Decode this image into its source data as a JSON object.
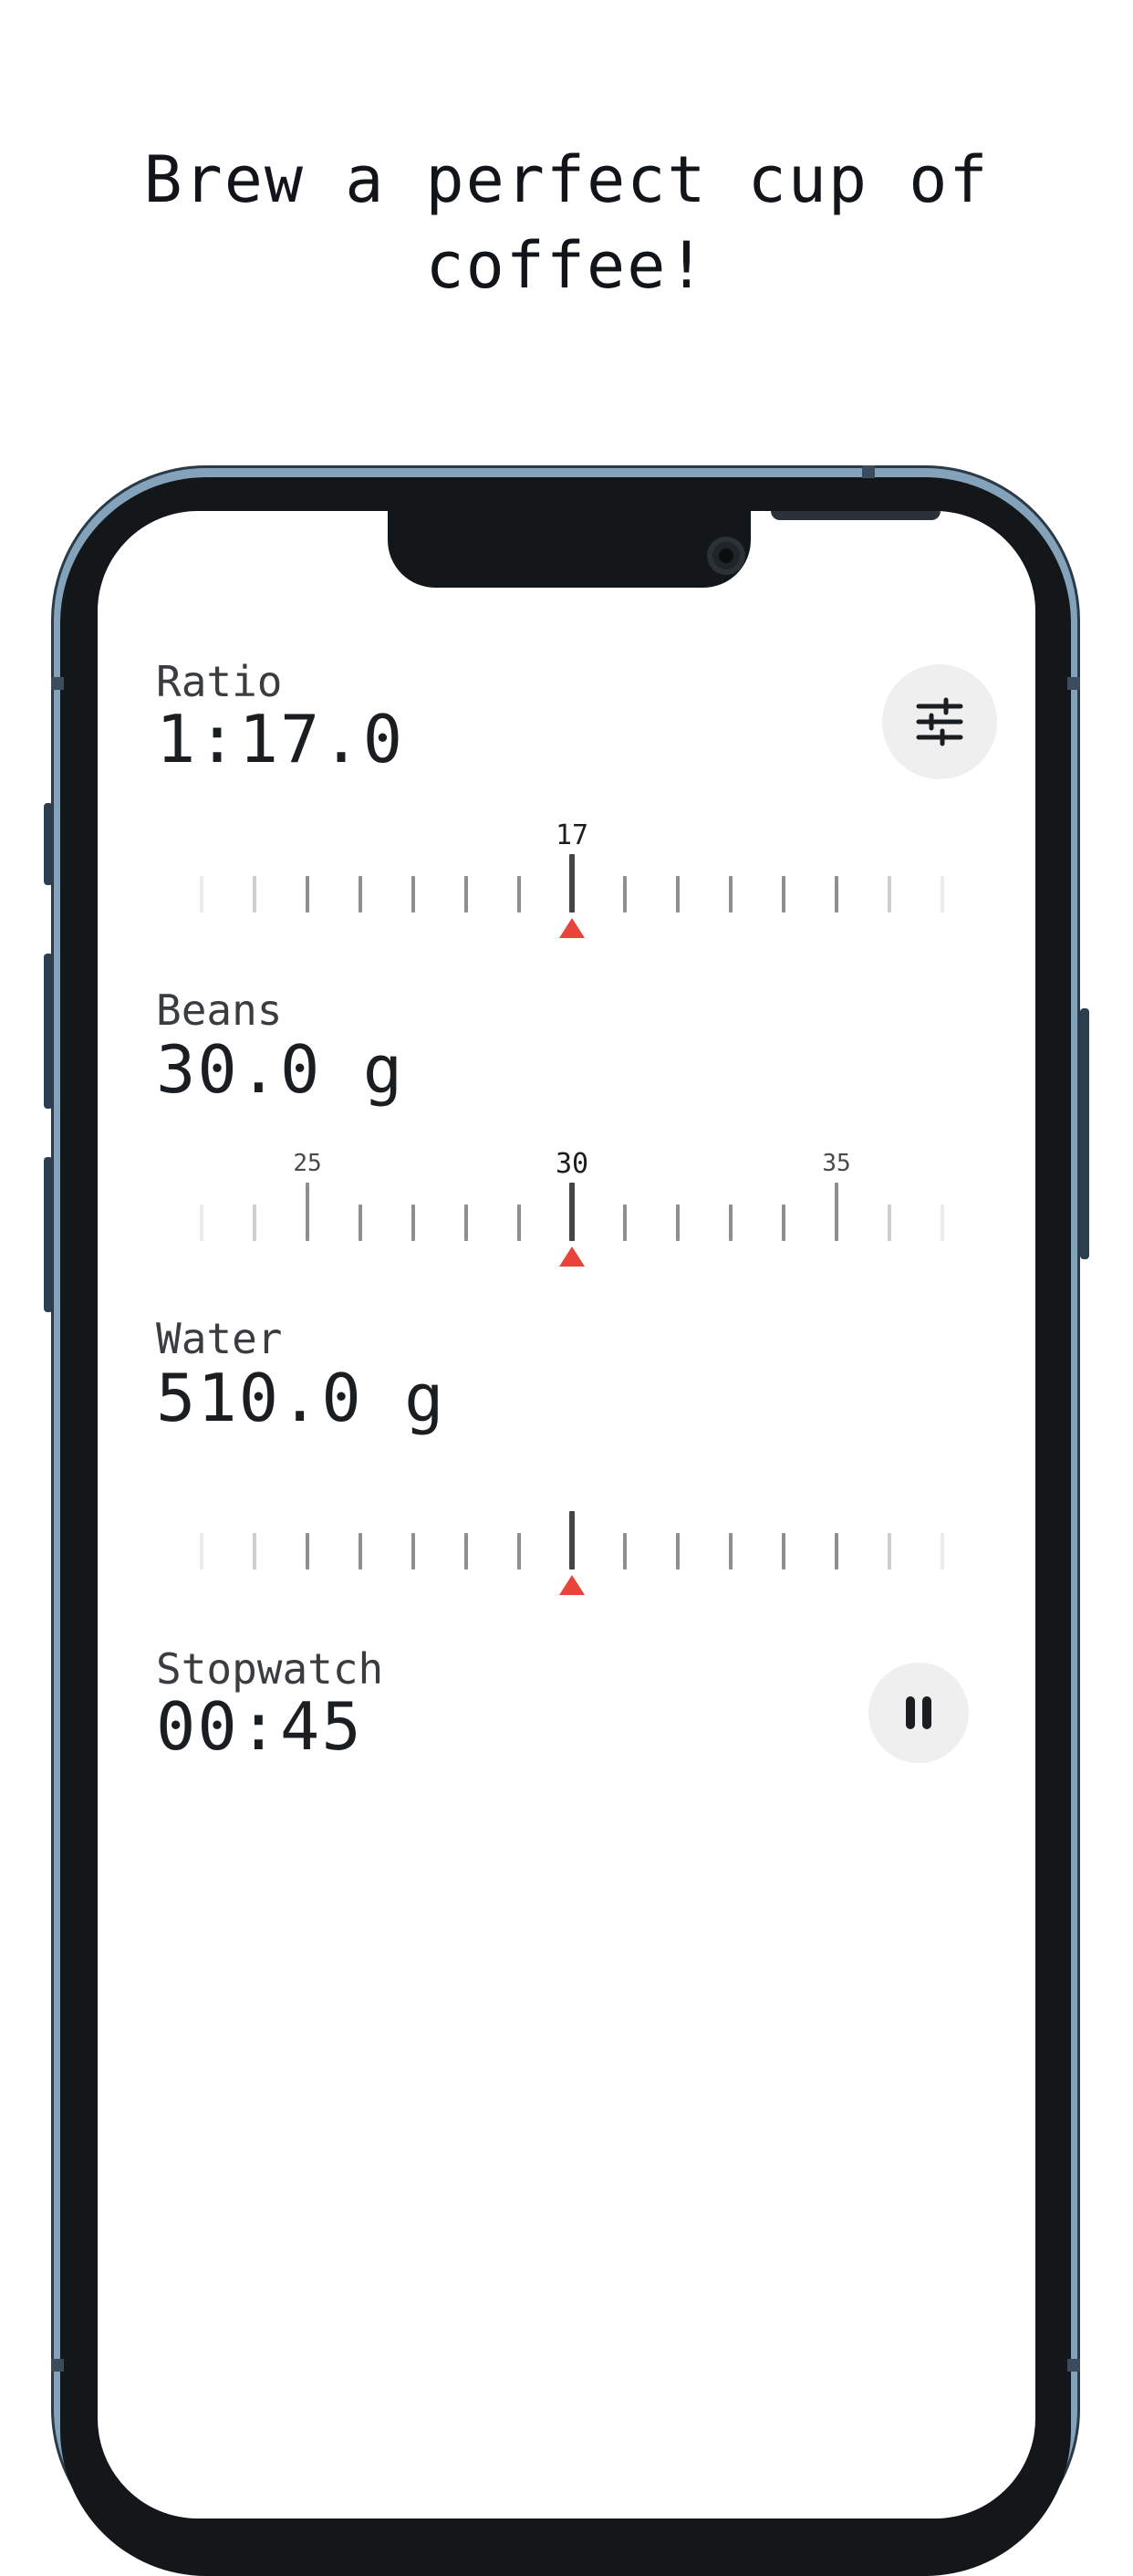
{
  "headline": "Brew a perfect cup of coffee!",
  "colors": {
    "frame": "#84a3bb",
    "bezel": "#141719",
    "pointer": "#e8443a",
    "button_bg": "#efefef"
  },
  "ratio": {
    "label": "Ratio",
    "value": "1:17.0",
    "settings_icon": "sliders-icon",
    "ruler": {
      "current": 17,
      "min": 10,
      "max": 24,
      "labels": [
        "17"
      ]
    }
  },
  "beans": {
    "label": "Beans",
    "value": "30.0 g",
    "ruler": {
      "current": 30,
      "min": 23,
      "max": 37,
      "labels": [
        "25",
        "30",
        "35"
      ]
    }
  },
  "water": {
    "label": "Water",
    "value": "510.0 g",
    "ruler": {
      "current": 510,
      "labels": []
    }
  },
  "stopwatch": {
    "label": "Stopwatch",
    "time": "00:45",
    "control_icon": "pause-icon"
  }
}
